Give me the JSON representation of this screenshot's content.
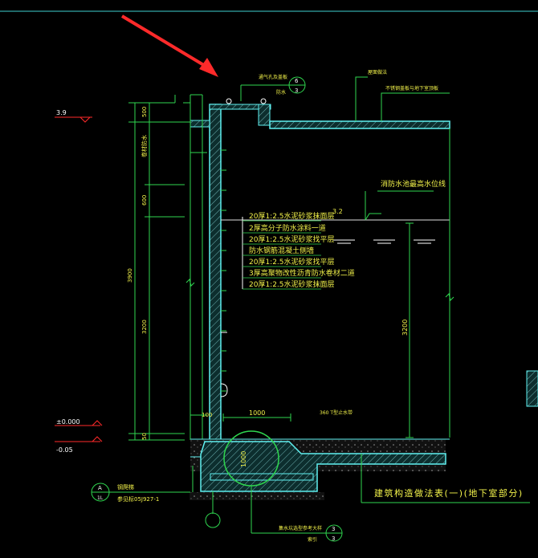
{
  "colors": {
    "background": "#000000",
    "wall_fill": "#103a3a",
    "hatch": "#7fbfbf",
    "cyan": "#5ff0f0",
    "green": "#2fd64f",
    "yellow": "#f2f24a",
    "white": "#ffffff",
    "red": "#ff2a2a"
  },
  "elevations": {
    "top_marker": "3.9",
    "zero_marker": "±0.000",
    "minus_marker": "-0.05",
    "water_level_value": "3.2"
  },
  "dimensions": {
    "left_segment_top": "500",
    "left_segment_mid": "600",
    "left_overall": "3900",
    "left_segment_lower": "3200",
    "left_segment_bottom": "50",
    "bottom_width": "1000",
    "pit_dimension": "1000",
    "right_height": "3200",
    "left_small_100": "100"
  },
  "labels": {
    "vert_label_left": "卷材防水",
    "top_small_label": "通气孔及盖板",
    "top_right_label_a": "屋面做法",
    "top_right_label_b": "不锈钢盖板与地下室顶板",
    "top_left_small": "防水",
    "water_level_label": "消防水池最高水位线",
    "bottom_mid_note": "360 T型止水带",
    "bottom_pit_label": "集水坑选型参考大样",
    "bottom_pit_sub": "索引",
    "left_detail_name": "钢爬梯",
    "left_detail_ref": "参见标05J927-1",
    "table_caption": "建筑构造做法表(一)(地下室部分)"
  },
  "layers": [
    "20厚1:2.5水泥砂浆抹面层",
    "2厚高分子防水涂料一道",
    "20厚1:2.5水泥砂浆找平层",
    "防水钢筋混凝土侧墙",
    "20厚1:2.5水泥砂浆找平层",
    "3厚高聚物改性沥青防水卷材二道",
    "20厚1:2.5水泥砂浆抹面层"
  ],
  "callouts": {
    "top_circle_num": "6",
    "top_circle_den": "3",
    "left_circle_top": "A",
    "left_circle_bottom": "1L",
    "bottom_circle_num": "3",
    "bottom_circle_den": "3"
  }
}
